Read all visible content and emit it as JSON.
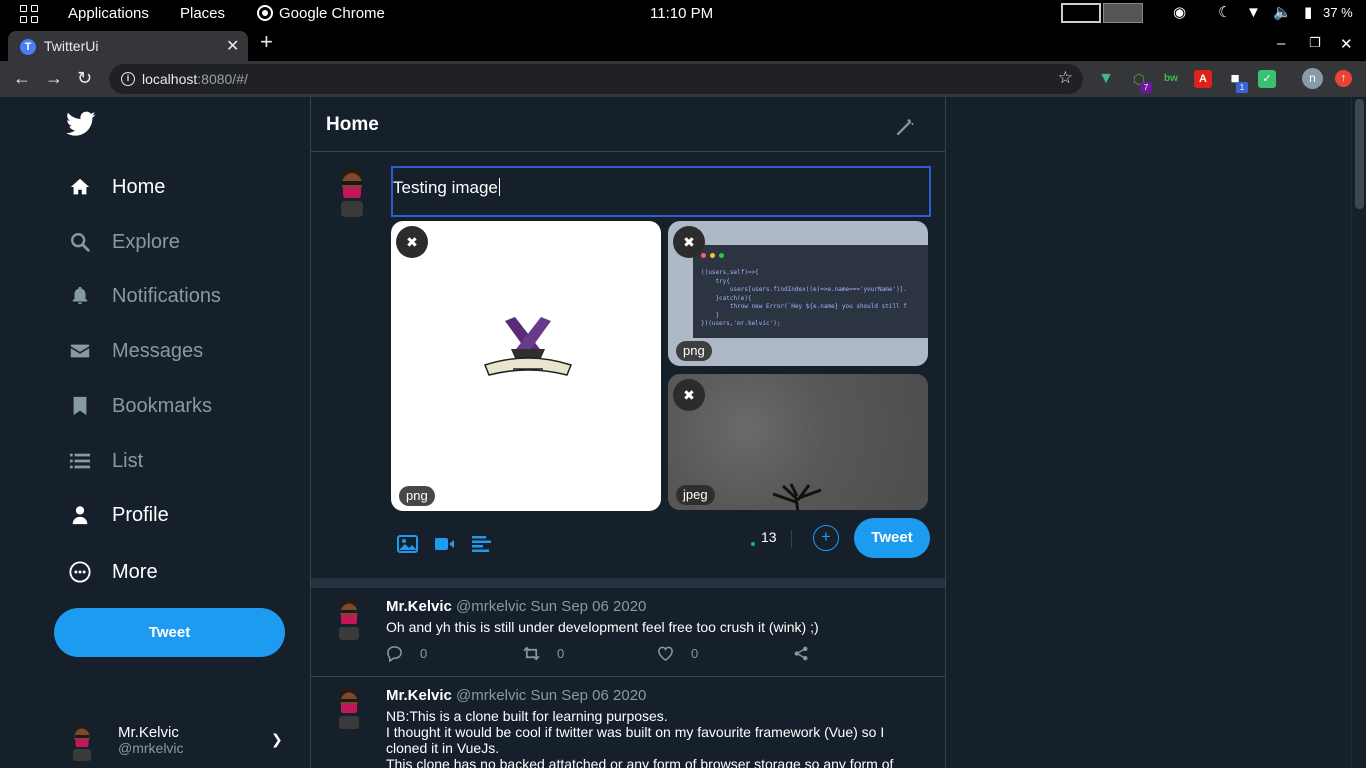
{
  "system_bar": {
    "applications": "Applications",
    "places": "Places",
    "browser": "Google Chrome",
    "clock": "11:10 PM",
    "battery": "37 %"
  },
  "browser": {
    "tab_title": "TwitterUi",
    "tab_favicon_letter": "T",
    "url_host": "localhost",
    "url_rest": ":8080/#/",
    "profile_initial": "n",
    "ext_badges": [
      "7",
      "1"
    ]
  },
  "sidebar": {
    "nav": [
      {
        "label": "Home",
        "icon": "home-icon"
      },
      {
        "label": "Explore",
        "icon": "search-icon"
      },
      {
        "label": "Notifications",
        "icon": "bell-icon"
      },
      {
        "label": "Messages",
        "icon": "envelope-icon"
      },
      {
        "label": "Bookmarks",
        "icon": "bookmark-icon"
      },
      {
        "label": "List",
        "icon": "list-icon"
      },
      {
        "label": "Profile",
        "icon": "user-icon"
      },
      {
        "label": "More",
        "icon": "more-circle-icon"
      }
    ],
    "tweet_button": "Tweet",
    "account": {
      "name": "Mr.Kelvic",
      "handle": "@mrkelvic"
    }
  },
  "main": {
    "title": "Home",
    "compose": {
      "text": "Testing image",
      "media": [
        {
          "format": "png"
        },
        {
          "format": "png"
        },
        {
          "format": "jpeg"
        }
      ],
      "char_count": "13",
      "tweet_button": "Tweet"
    },
    "posts": [
      {
        "name": "Mr.Kelvic",
        "handle": "@mrkelvic",
        "date": "Sun Sep 06 2020",
        "lines": [
          "Oh and yh this is still under development feel free too crush it (wink) ;)"
        ],
        "replies": "0",
        "retweets": "0",
        "likes": "0"
      },
      {
        "name": "Mr.Kelvic",
        "handle": "@mrkelvic",
        "date": "Sun Sep 06 2020",
        "lines": [
          "NB:This is a clone built for learning purposes.",
          "I thought it would be cool if twitter was built on my favourite framework (Vue) so I",
          "cloned it in VueJs.",
          "This clone has no backed attatched or any form of browser storage so any form of"
        ]
      }
    ]
  },
  "colors": {
    "background": "#15202b",
    "accent": "#1d9bf0",
    "muted": "#8899a6",
    "border": "#38444d"
  }
}
